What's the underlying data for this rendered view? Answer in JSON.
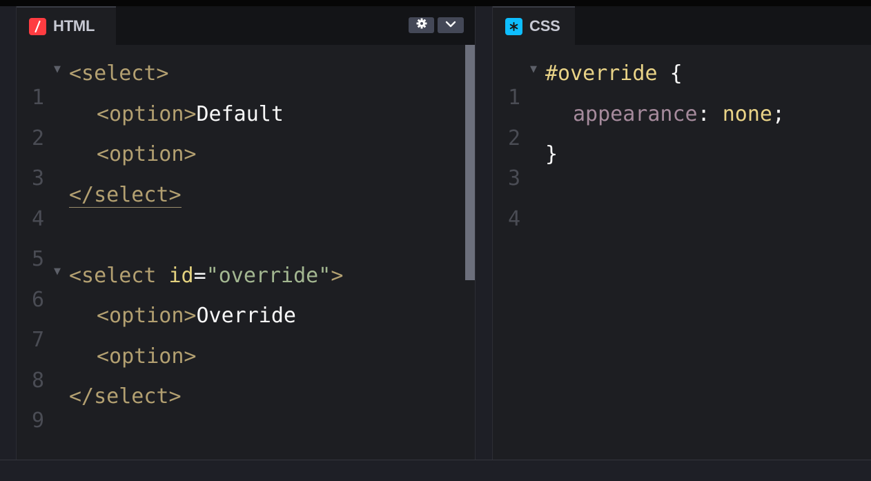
{
  "html_pane": {
    "tab_label": "HTML",
    "icon": "html-slash-icon",
    "icon_color": "#ff3c41",
    "settings_icon": "gear-icon",
    "collapse_icon": "chevron-down-icon",
    "lines": [
      {
        "n": "1",
        "folds": true
      },
      {
        "n": "2"
      },
      {
        "n": "3"
      },
      {
        "n": "4"
      },
      {
        "n": "5"
      },
      {
        "n": "6",
        "folds": true
      },
      {
        "n": "7"
      },
      {
        "n": "8"
      },
      {
        "n": "9"
      }
    ],
    "code": {
      "l1_tag": "<select>",
      "l2_tag": "<option>",
      "l2_text": "Default",
      "l3_tag": "<option>",
      "l4_tag": "</select>",
      "l6_tag_open": "<select ",
      "l6_attr": "id",
      "l6_eq": "=",
      "l6_str": "\"override\"",
      "l6_tag_close": ">",
      "l7_tag": "<option>",
      "l7_text": "Override",
      "l8_tag": "<option>",
      "l9_tag": "</select>"
    }
  },
  "css_pane": {
    "tab_label": "CSS",
    "icon": "css-asterisk-icon",
    "icon_color": "#0ebeff",
    "lines": [
      {
        "n": "1",
        "folds": true
      },
      {
        "n": "2"
      },
      {
        "n": "3"
      },
      {
        "n": "4"
      }
    ],
    "code": {
      "l1_sel": "#override",
      "l1_brace": " {",
      "l2_prop": "appearance",
      "l2_colon": ": ",
      "l2_val": "none",
      "l2_semi": ";",
      "l3_brace": "}"
    }
  }
}
